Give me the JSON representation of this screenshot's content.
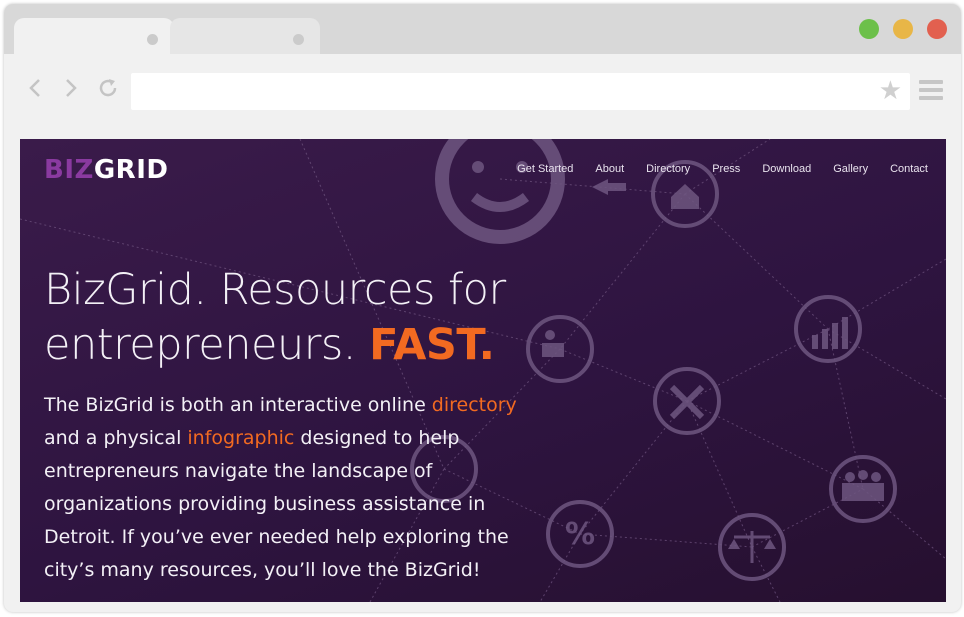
{
  "browser": {
    "tabs": [
      {
        "label": ""
      },
      {
        "label": ""
      }
    ],
    "url": "",
    "icons": {
      "back": "chevron-left-icon",
      "forward": "chevron-right-icon",
      "reload": "reload-icon",
      "bookmark": "star-icon",
      "menu": "hamburger-menu-icon"
    },
    "window_button_colors": {
      "green": "#6cc04a",
      "yellow": "#e8b647",
      "red": "#e2604f"
    }
  },
  "site": {
    "logo": {
      "part1": "BIZ",
      "part2": "GRID"
    },
    "nav": [
      "Get Started",
      "About",
      "Directory",
      "Press",
      "Download",
      "Gallery",
      "Contact"
    ],
    "headline": {
      "line1": "BizGrid. Resources for",
      "line2": "entrepreneurs. ",
      "accent": "FAST."
    },
    "body": {
      "t1": "The BizGrid is both an interactive online ",
      "link1": "directory",
      "t2": " and a physical ",
      "link2": "infographic",
      "t3": " designed to help entrepreneurs navigate the landscape of organizations providing business assistance in Detroit. If you’ve ever needed help exploring the city’s many resources, you’ll love the BizGrid!"
    },
    "colors": {
      "accent": "#f26a21",
      "background": "#2e1440",
      "logo_purple": "#8a3aa0"
    },
    "background_icons": [
      "smiley-icon",
      "house-icon",
      "arrow-left-icon",
      "chart-icon",
      "desk-worker-icon",
      "tools-icon",
      "document-icon",
      "percent-icon",
      "people-icon",
      "scales-icon"
    ]
  }
}
